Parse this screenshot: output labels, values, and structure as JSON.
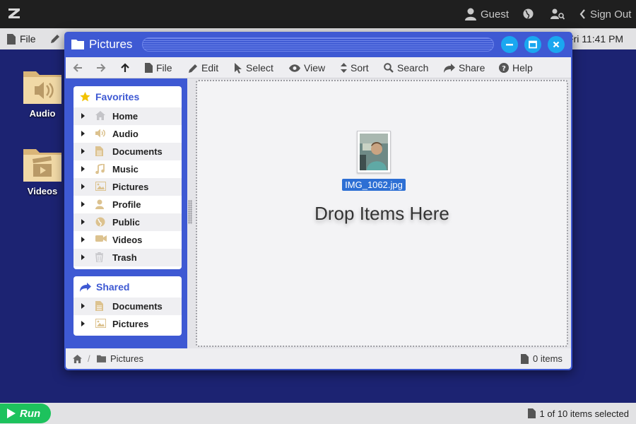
{
  "topbar": {
    "logo_icon": "app-logo-icon",
    "user_label": "Guest",
    "signout_label": "Sign Out"
  },
  "menubar": {
    "file_label": "File",
    "clock": "Fri 11:41 PM"
  },
  "desktop": {
    "icons": [
      {
        "label": "Audio",
        "icon": "audio-folder-icon"
      },
      {
        "label": "Videos",
        "icon": "video-folder-icon"
      }
    ]
  },
  "window": {
    "title": "Pictures",
    "toolbar": {
      "file": "File",
      "edit": "Edit",
      "select": "Select",
      "view": "View",
      "sort": "Sort",
      "search": "Search",
      "share": "Share",
      "help": "Help"
    },
    "favorites": {
      "heading": "Favorites",
      "items": [
        "Home",
        "Audio",
        "Documents",
        "Music",
        "Pictures",
        "Profile",
        "Public",
        "Videos",
        "Trash"
      ]
    },
    "shared": {
      "heading": "Shared",
      "items": [
        "Documents",
        "Pictures"
      ]
    },
    "content": {
      "file_name": "IMG_1062.jpg",
      "drop_text": "Drop Items Here"
    },
    "statusbar": {
      "breadcrumb_sep": "/",
      "breadcrumb_folder": "Pictures",
      "item_count": "0 items"
    }
  },
  "bottombar": {
    "run_label": "Run",
    "selection_status": "1 of 10 items selected"
  },
  "colors": {
    "accent": "#3e59d3",
    "desktop": "#1c2372",
    "window_button": "#1aa7f0",
    "run_button": "#1dc25d",
    "selection": "#2d6fd4"
  }
}
